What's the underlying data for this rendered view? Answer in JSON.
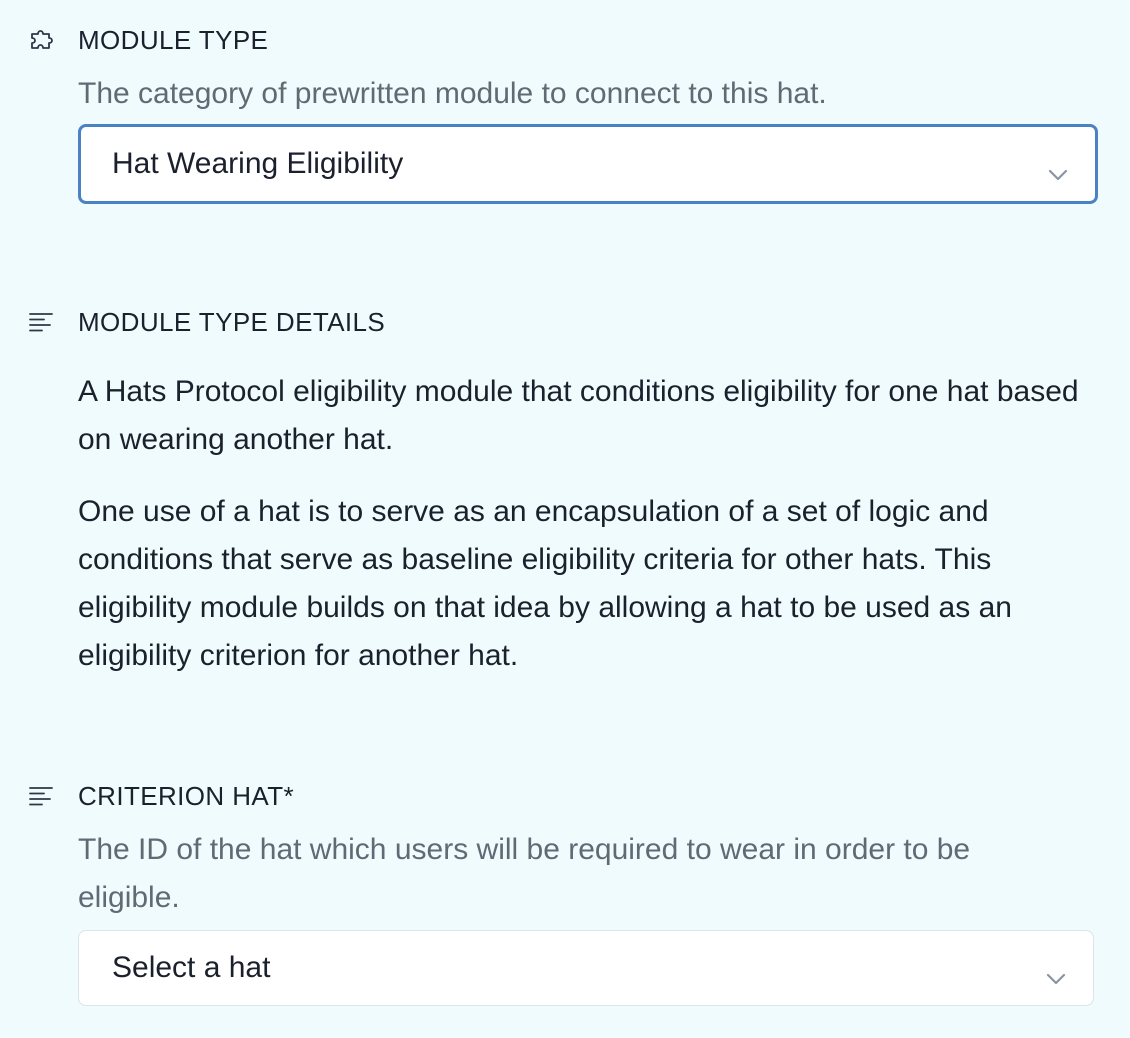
{
  "module_type": {
    "title": "MODULE TYPE",
    "icon": "puzzle-icon",
    "helper": "The category of prewritten module to connect to this hat.",
    "select": {
      "value": "Hat Wearing Eligibility"
    }
  },
  "module_type_details": {
    "title": "MODULE TYPE DETAILS",
    "icon": "text-align-icon",
    "paragraphs": [
      "A Hats Protocol eligibility module that conditions eligibility for one hat based on wearing another hat.",
      "One use of a hat is to serve as an encapsulation of a set of logic and conditions that serve as baseline eligibility criteria for other hats. This eligibility module builds on that idea by allowing a hat to be used as an eligibility criterion for another hat."
    ]
  },
  "criterion_hat": {
    "title": "CRITERION HAT*",
    "icon": "text-align-icon",
    "helper": "The ID of the hat which users will be required to wear in order to be eligible.",
    "select": {
      "value": "Select a hat"
    }
  },
  "colors": {
    "background": "#f0fbfd",
    "focus_border": "#4a82c4",
    "helper_text": "#5f6a75",
    "body_text": "#1a202c"
  }
}
